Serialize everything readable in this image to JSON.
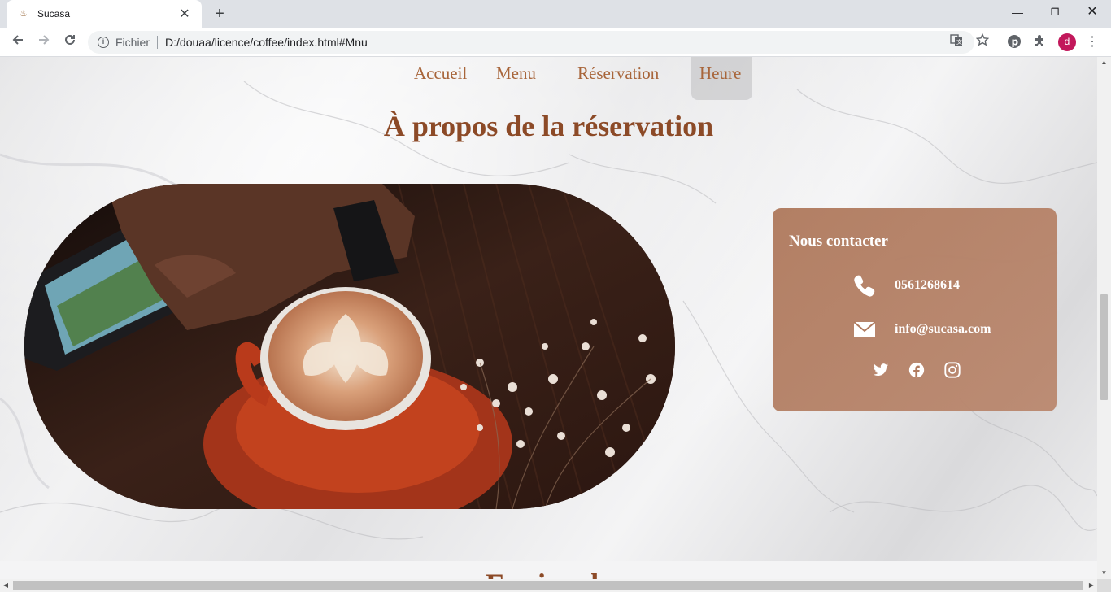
{
  "browser": {
    "tab_title": "Sucasa",
    "address_scheme": "Fichier",
    "address_url": "D:/douaa/licence/coffee/index.html#Mnu",
    "profile_initial": "d"
  },
  "site": {
    "nav": {
      "home": "Accueil",
      "menu": "Menu",
      "reservation": "Réservation",
      "hours": "Heure"
    },
    "section_title": "À propos de la réservation",
    "contact": {
      "title": "Nous contacter",
      "phone": "0561268614",
      "email": "info@sucasa.com",
      "socials": [
        "twitter-icon",
        "facebook-icon",
        "instagram-icon"
      ]
    },
    "next_section_title": "Equipe de"
  },
  "colors": {
    "accent_text": "#a8653a",
    "heading": "#8c4a27",
    "card_bg": "#b07b5f",
    "avatar": "#c2185b"
  }
}
